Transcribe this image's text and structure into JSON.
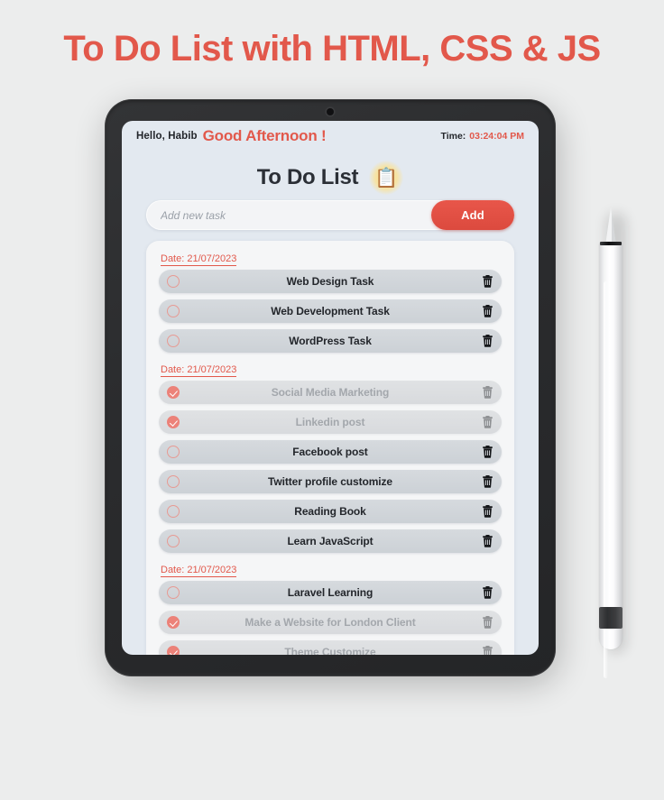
{
  "page": {
    "heading": "To Do List with HTML, CSS & JS",
    "heading_color": "#e2584b",
    "background_color": "#eceded"
  },
  "device": {
    "type": "tablet",
    "camera_icon": "camera-dot-icon",
    "accessory": "stylus-pen"
  },
  "app": {
    "topbar": {
      "greeting_name": "Hello, Habib",
      "greeting_message": "Good Afternoon !",
      "time_label": "Time:",
      "time_value": "03:24:04 PM"
    },
    "title": "To Do List",
    "title_emoji": "📋",
    "title_emoji_name": "clipboard-emoji",
    "input": {
      "placeholder": "Add new task",
      "value": "",
      "add_label": "Add"
    },
    "accent_color": "#e2584b",
    "check_color": "#ec8279",
    "groups": [
      {
        "date_label": "Date: 21/07/2023",
        "tasks": [
          {
            "text": "Web Design Task",
            "done": false
          },
          {
            "text": "Web Development Task",
            "done": false
          },
          {
            "text": "WordPress Task",
            "done": false
          }
        ]
      },
      {
        "date_label": "Date: 21/07/2023",
        "tasks": [
          {
            "text": "Social Media Marketing",
            "done": true
          },
          {
            "text": "Linkedin post",
            "done": true
          },
          {
            "text": "Facebook post",
            "done": false
          },
          {
            "text": "Twitter profile customize",
            "done": false
          },
          {
            "text": "Reading Book",
            "done": false
          },
          {
            "text": "Learn JavaScript",
            "done": false
          }
        ]
      },
      {
        "date_label": "Date: 21/07/2023",
        "tasks": [
          {
            "text": "Laravel Learning",
            "done": false
          },
          {
            "text": "Make a Website for London Client",
            "done": true
          },
          {
            "text": "Theme Customize",
            "done": true
          }
        ]
      }
    ]
  }
}
